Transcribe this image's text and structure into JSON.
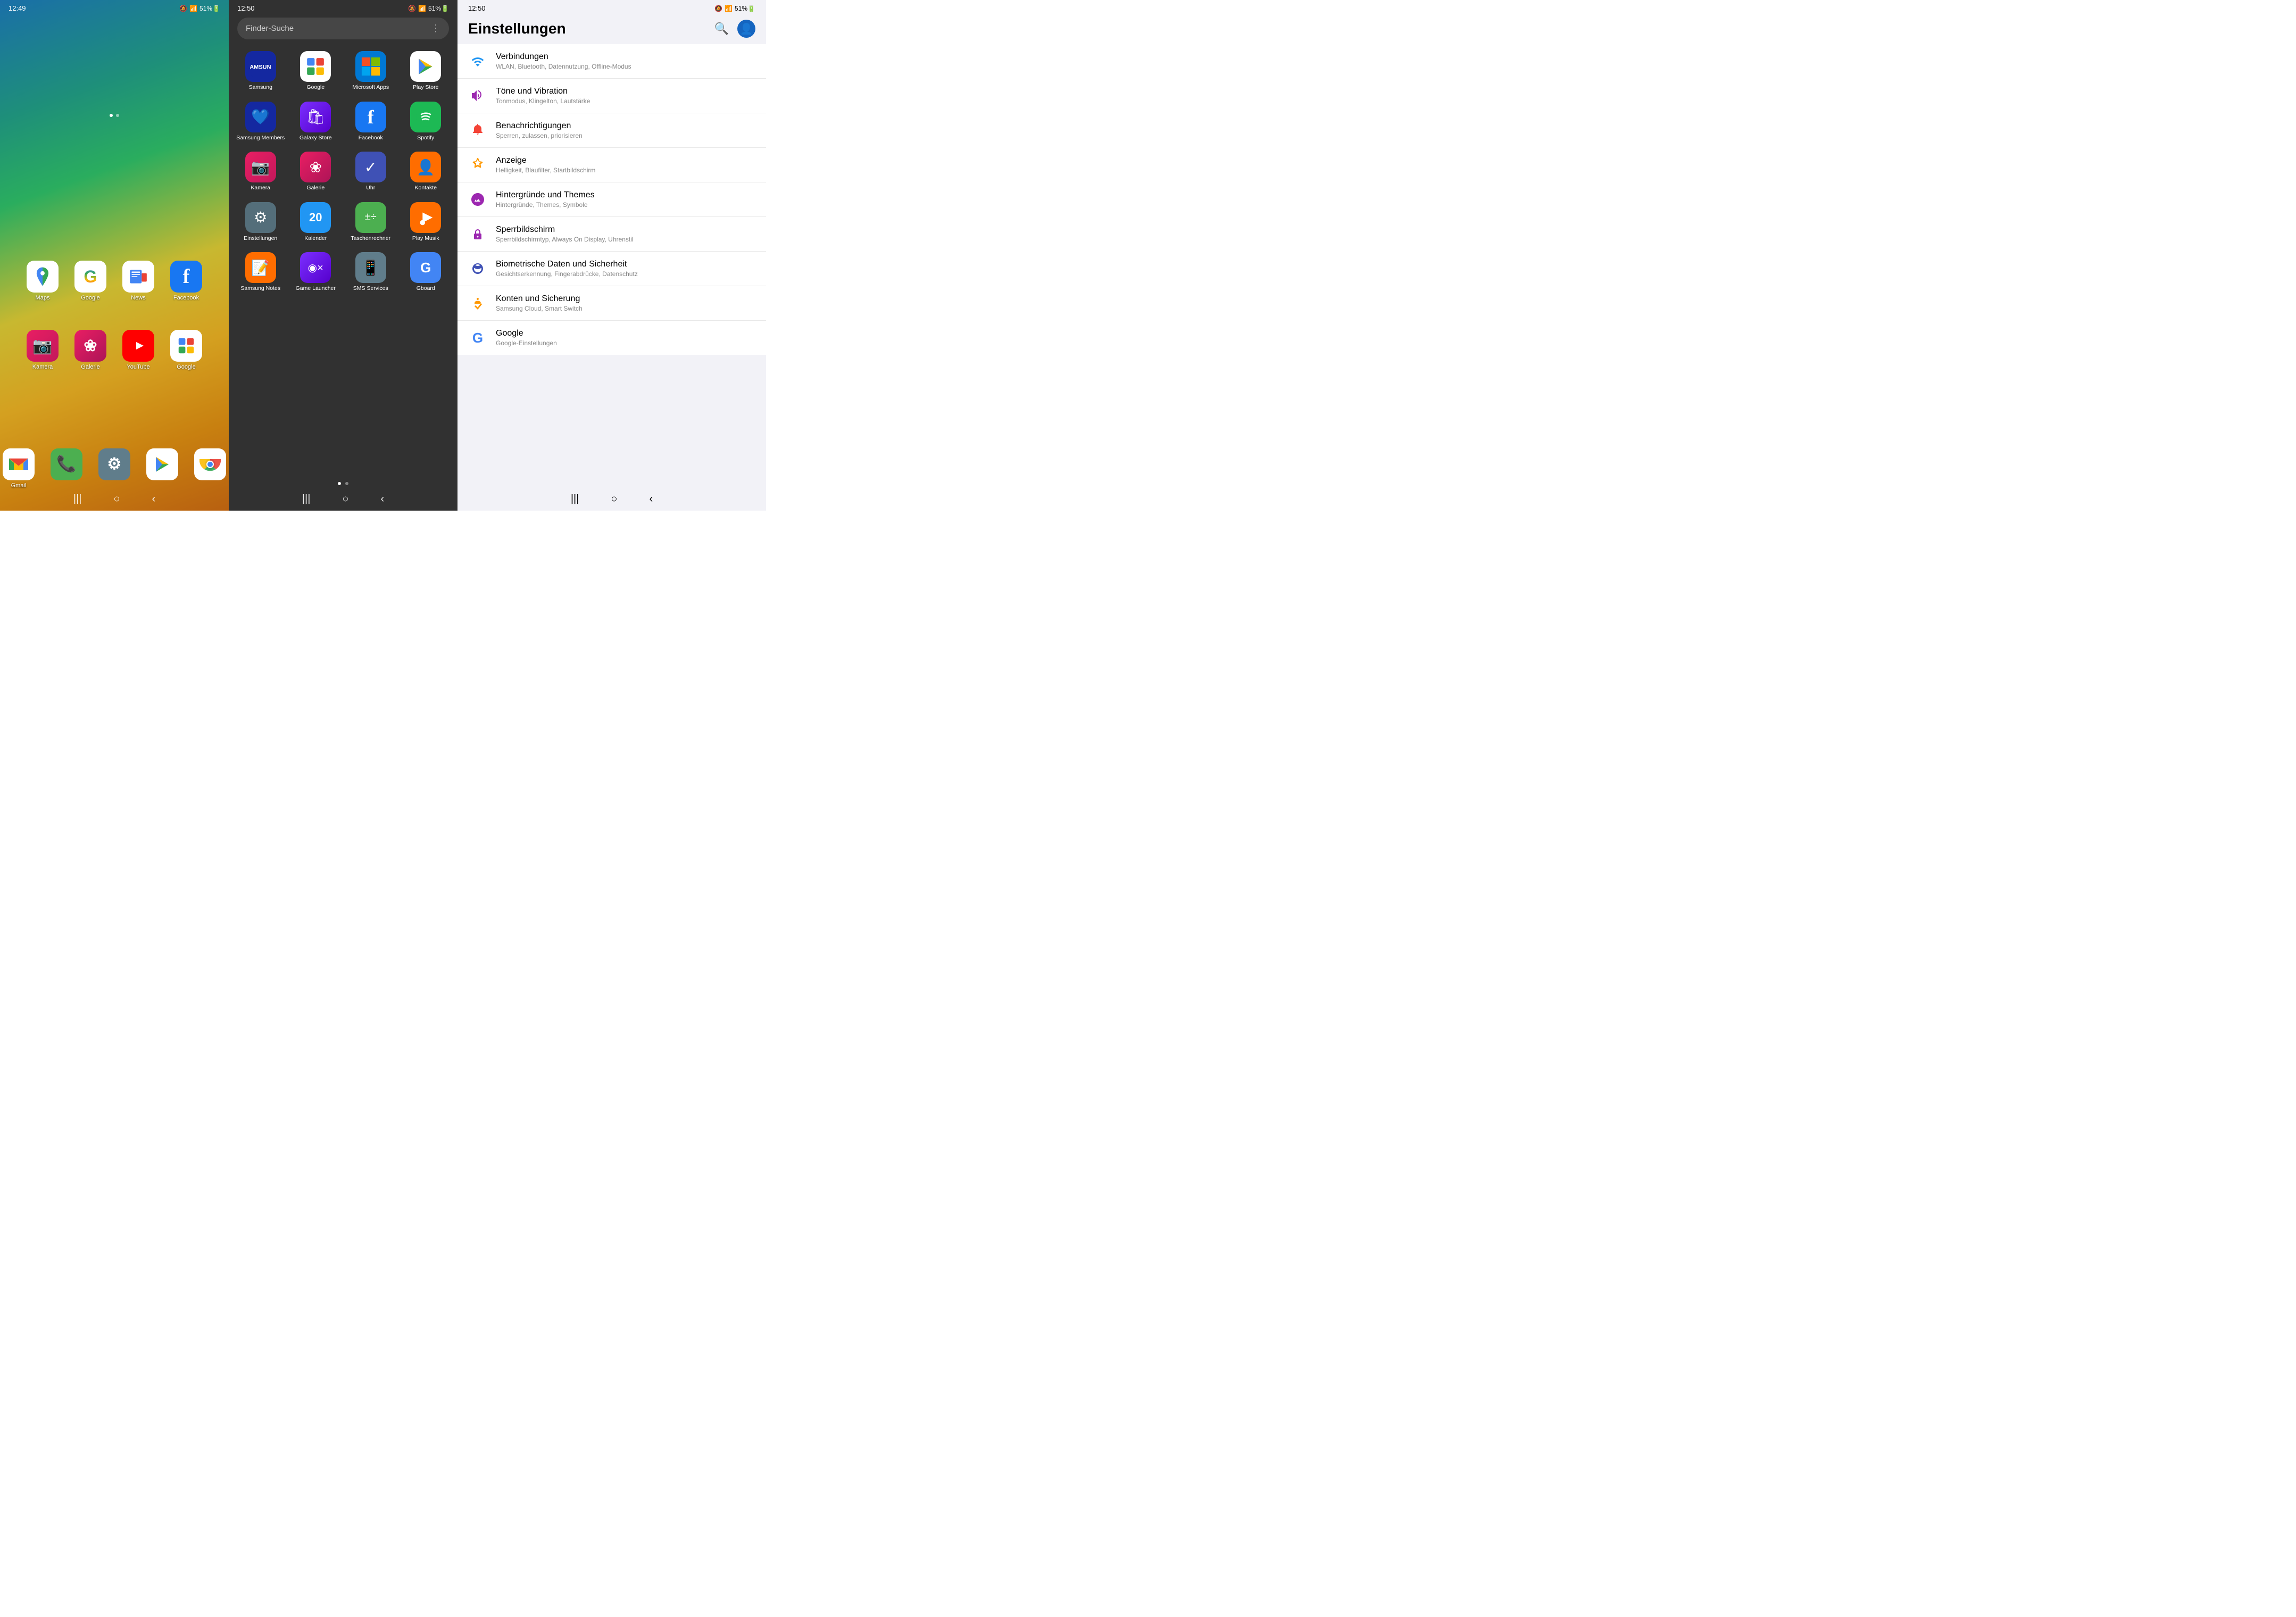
{
  "panel1": {
    "time": "12:49",
    "statusIcons": "🔕 📶 51% 🔋",
    "row1Apps": [
      {
        "label": "Maps",
        "icon": "📍",
        "bg": "ic-maps"
      },
      {
        "label": "Google",
        "icon": "G",
        "bg": "ic-google"
      },
      {
        "label": "News",
        "icon": "📰",
        "bg": "ic-news"
      },
      {
        "label": "Facebook",
        "icon": "f",
        "bg": "ic-facebook"
      }
    ],
    "row2Apps": [
      {
        "label": "Kamera",
        "icon": "📷",
        "bg": "ic-kamera"
      },
      {
        "label": "Galerie",
        "icon": "❀",
        "bg": "ic-galerie"
      },
      {
        "label": "YouTube",
        "icon": "▶",
        "bg": "ic-youtube"
      },
      {
        "label": "Google",
        "icon": "G",
        "bg": "ic-google2"
      }
    ],
    "dockApps": [
      {
        "label": "Gmail",
        "icon": "M",
        "bg": "ic-gmail"
      },
      {
        "label": "Phone",
        "icon": "📞",
        "bg": "ic-phone"
      },
      {
        "label": "Settings",
        "icon": "⚙",
        "bg": "ic-settings"
      },
      {
        "label": "Play Store",
        "icon": "▶",
        "bg": "ic-playstore"
      },
      {
        "label": "Chrome",
        "icon": "●",
        "bg": "ic-chrome"
      }
    ],
    "navButtons": [
      "|||",
      "○",
      "‹"
    ],
    "pageDot": "active"
  },
  "panel2": {
    "time": "12:50",
    "statusIcons": "🔕 📶 51% 🔋",
    "searchPlaceholder": "Finder-Suche",
    "apps": [
      {
        "label": "Samsung",
        "icon": "⬡",
        "bg": "ic-samsung"
      },
      {
        "label": "Google",
        "icon": "G",
        "bg": "ic-googled"
      },
      {
        "label": "Microsoft Apps",
        "icon": "⊞",
        "bg": "ic-msapps"
      },
      {
        "label": "Play Store",
        "icon": "▶",
        "bg": "ic-playstoredraw"
      },
      {
        "label": "Samsung Members",
        "icon": "♥",
        "bg": "ic-samsungmem"
      },
      {
        "label": "Galaxy Store",
        "icon": "🛍",
        "bg": "ic-galaxystore"
      },
      {
        "label": "Facebook",
        "icon": "f",
        "bg": "ic-facebookd"
      },
      {
        "label": "Spotify",
        "icon": "♪",
        "bg": "ic-spotify"
      },
      {
        "label": "Kamera",
        "icon": "📷",
        "bg": "ic-kamerad"
      },
      {
        "label": "Galerie",
        "icon": "❀",
        "bg": "ic-galeried"
      },
      {
        "label": "Uhr",
        "icon": "✓",
        "bg": "ic-uhrd"
      },
      {
        "label": "Kontakte",
        "icon": "👤",
        "bg": "ic-kontakte"
      },
      {
        "label": "Einstellungen",
        "icon": "⚙",
        "bg": "ic-einstellungen"
      },
      {
        "label": "Kalender",
        "icon": "20",
        "bg": "ic-kalender"
      },
      {
        "label": "Taschenrechner",
        "icon": "±÷",
        "bg": "ic-rechner"
      },
      {
        "label": "Play Musik",
        "icon": "▶",
        "bg": "ic-playmusik"
      },
      {
        "label": "Samsung Notes",
        "icon": "📝",
        "bg": "ic-snotes"
      },
      {
        "label": "Game Launcher",
        "icon": "◉×",
        "bg": "ic-game"
      },
      {
        "label": "SMS Services",
        "icon": "📱",
        "bg": "ic-sms"
      },
      {
        "label": "Gboard",
        "icon": "G",
        "bg": "ic-gboard"
      }
    ],
    "navButtons": [
      "|||",
      "○",
      "‹"
    ],
    "pageDots": [
      "active",
      ""
    ]
  },
  "panel3": {
    "time": "12:50",
    "statusIcons": "🔕 📶 51% 🔋",
    "title": "Einstellungen",
    "items": [
      {
        "icon": "📶",
        "iconClass": "sic-wifi",
        "label": "Verbindungen",
        "sublabel": "WLAN, Bluetooth, Datennutzung, Offline-Modus"
      },
      {
        "icon": "🔊",
        "iconClass": "sic-sound",
        "label": "Töne und Vibration",
        "sublabel": "Tonmodus, Klingelton, Lautstärke"
      },
      {
        "icon": "🔔",
        "iconClass": "sic-notif",
        "label": "Benachrichtigungen",
        "sublabel": "Sperren, zulassen, priorisieren"
      },
      {
        "icon": "☀",
        "iconClass": "sic-display",
        "label": "Anzeige",
        "sublabel": "Helligkeit, Blaufilter, Startbildschirm"
      },
      {
        "icon": "🖼",
        "iconClass": "sic-wallpaper",
        "label": "Hintergründe und Themes",
        "sublabel": "Hintergründe, Themes, Symbole"
      },
      {
        "icon": "🔒",
        "iconClass": "sic-lock",
        "label": "Sperrbildschirm",
        "sublabel": "Sperrbildschirmtyp, Always On Display, Uhrenstil"
      },
      {
        "icon": "🛡",
        "iconClass": "sic-biometric",
        "label": "Biometrische Daten und Sicherheit",
        "sublabel": "Gesichtserkennung, Fingerabdrücke, Datenschutz"
      },
      {
        "icon": "🔑",
        "iconClass": "sic-accounts",
        "label": "Konten und Sicherung",
        "sublabel": "Samsung Cloud, Smart Switch"
      },
      {
        "icon": "G",
        "iconClass": "sic-google",
        "label": "Google",
        "sublabel": "Google-Einstellungen"
      }
    ],
    "navButtons": [
      "|||",
      "○",
      "‹"
    ]
  }
}
